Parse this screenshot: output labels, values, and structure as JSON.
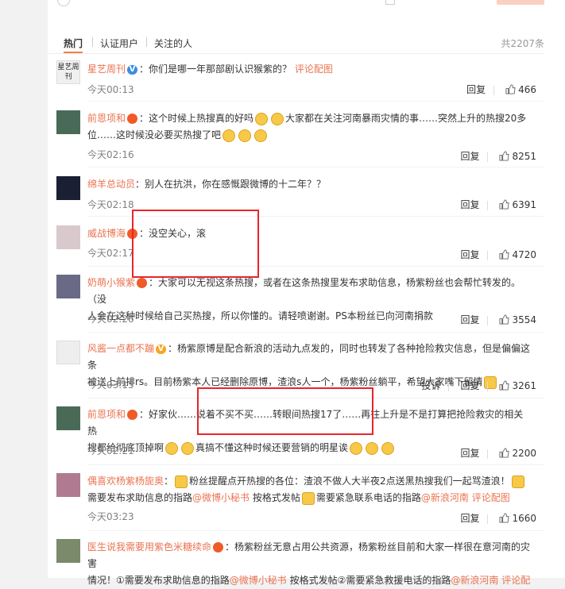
{
  "tabs": {
    "hot": "热门",
    "verified": "认证用户",
    "following": "关注的人",
    "total": "共2207条"
  },
  "comments": [
    {
      "user": "星艺周刊",
      "content": "你们是哪一年那部剧认识猴紫的？",
      "link": "评论配图",
      "time": "今天00:13",
      "reply": "回复",
      "likes": "466",
      "avatar_label": "星艺周刊",
      "avatar_color": "#e8e8e8"
    },
    {
      "user": "前恩项和",
      "content_a": "：这个时候上热搜真的好吗",
      "content_b": "大家都在关注河南暴雨灾情的事……突然上升的热搜20多",
      "content_c": "位……这时候没必要买热搜了吧",
      "time": "今天02:16",
      "reply": "回复",
      "likes": "8251",
      "avatar_color": "#4a6a58"
    },
    {
      "user": "绵羊总动员",
      "content": "：别人在抗洪，你在感慨跟微博的十二年？？",
      "time": "今天02:18",
      "reply": "回复",
      "likes": "6391",
      "avatar_color": "#1a1f33"
    },
    {
      "user": "威战博海",
      "content": "：没空关心，滚",
      "time": "今天02:17",
      "reply": "回复",
      "likes": "4720",
      "avatar_color": "#d9c9cc"
    },
    {
      "user": "奶萌小猴紫",
      "content_a": "：大家可以无视这条热搜，或者在这条热搜里发布求助信息，杨紫粉丝也会帮忙转发的。（没",
      "content_b": "人会在这种时候给自己买热搜，所以你懂的。请轻喷谢谢。PS本粉丝已向河南捐款",
      "time": "今天02:26",
      "reply": "回复",
      "likes": "3554",
      "avatar_color": "#6a6a86"
    },
    {
      "user": "风酱一点都不蹦",
      "content_a": "：杨紫原博是配合新浪的活动九点发的，同时也转发了各种抢险救灾信息，但是偏偏这条",
      "content_b": "被送上前排rs。目前杨紫本人已经删除原博，渣浪s人一个，杨紫粉丝躺平，希望大家嘴下留情",
      "time": "今天03:15",
      "report": "投诉",
      "reply": "回复",
      "likes": "3261",
      "avatar_color": "#eeeeee"
    },
    {
      "user": "前恩项和",
      "content_a": "：好家伙……说着不买不买……转眼间热搜17了……再往上升是不是打算把抢险救灾的相关热",
      "content_b": "搜都给彻底顶掉啊",
      "content_c": "真搞不懂这种时候还要营销的明星诶",
      "time": "今天02:21",
      "reply": "回复",
      "likes": "2200",
      "avatar_color": "#4a6a58"
    },
    {
      "user": "偶喜欢杨紫杨旎奥",
      "content_a": "粉丝提醒点开热搜的各位：渣浪不做人大半夜2点送黑热搜我们一起骂渣浪！",
      "content_b": "需要发布求助信息的指路",
      "link1": "@微博小秘书",
      "content_c": "按格式发帖",
      "content_d": "需要紧急联系电话的指路",
      "link2": "@新浪河南",
      "link3": "评论配图",
      "time": "今天03:23",
      "reply": "回复",
      "likes": "1660",
      "avatar_color": "#b07a90"
    },
    {
      "user": "医生说我需要用紫色米糖续命",
      "content_a": "：杨紫粉丝无意占用公共资源，杨紫粉丝目前和大家一样很在意河南的灾害",
      "content_b": "情况！①需要发布求助信息的指路",
      "link1": "@微博小秘书",
      "content_c": "按格式发帖②需要紧急救援电话的指路",
      "link2": "@新浪河南",
      "link3": "评论配",
      "avatar_color": "#7a8a6a"
    }
  ],
  "colors": {
    "accent": "#eb7350",
    "highlight_box": "#e8242c",
    "tab_underline": "#fa7d3c"
  }
}
